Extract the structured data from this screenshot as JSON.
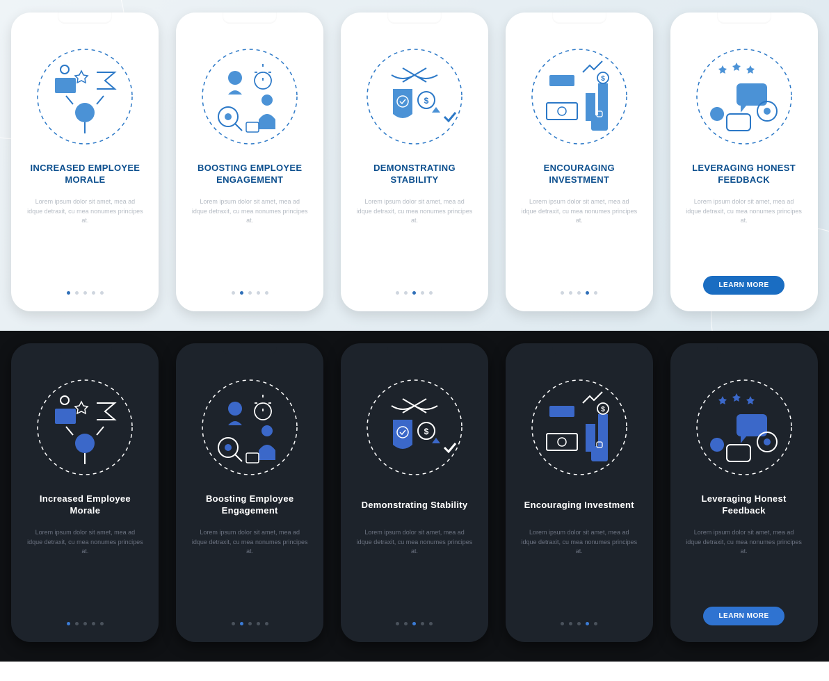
{
  "slides": [
    {
      "titleLight": "INCREASED EMPLOYEE MORALE",
      "titleDark": "Increased Employee Morale",
      "desc": "Lorem ipsum dolor sit amet, mea ad idque detraxit, cu mea nonumes principes at.",
      "icon": "morale-icon",
      "active": 0
    },
    {
      "titleLight": "BOOSTING EMPLOYEE ENGAGEMENT",
      "titleDark": "Boosting Employee Engagement",
      "desc": "Lorem ipsum dolor sit amet, mea ad idque detraxit, cu mea nonumes principes at.",
      "icon": "engagement-icon",
      "active": 1
    },
    {
      "titleLight": "DEMONSTRATING STABILITY",
      "titleDark": "Demonstrating Stability",
      "desc": "Lorem ipsum dolor sit amet, mea ad idque detraxit, cu mea nonumes principes at.",
      "icon": "stability-icon",
      "active": 2
    },
    {
      "titleLight": "ENCOURAGING INVESTMENT",
      "titleDark": "Encouraging Investment",
      "desc": "Lorem ipsum dolor sit amet, mea ad idque detraxit, cu mea nonumes principes at.",
      "icon": "investment-icon",
      "active": 3
    },
    {
      "titleLight": "LEVERAGING HONEST FEEDBACK",
      "titleDark": "Leveraging Honest Feedback",
      "desc": "Lorem ipsum dolor sit amet, mea ad idque detraxit, cu mea nonumes principes at.",
      "icon": "feedback-icon",
      "active": 4,
      "cta": "LEARN MORE"
    }
  ],
  "colors": {
    "lightStroke": "#2b78c7",
    "lightFill": "#4b92d6",
    "darkStroke": "#ffffff",
    "darkFill": "#3b68c9"
  }
}
